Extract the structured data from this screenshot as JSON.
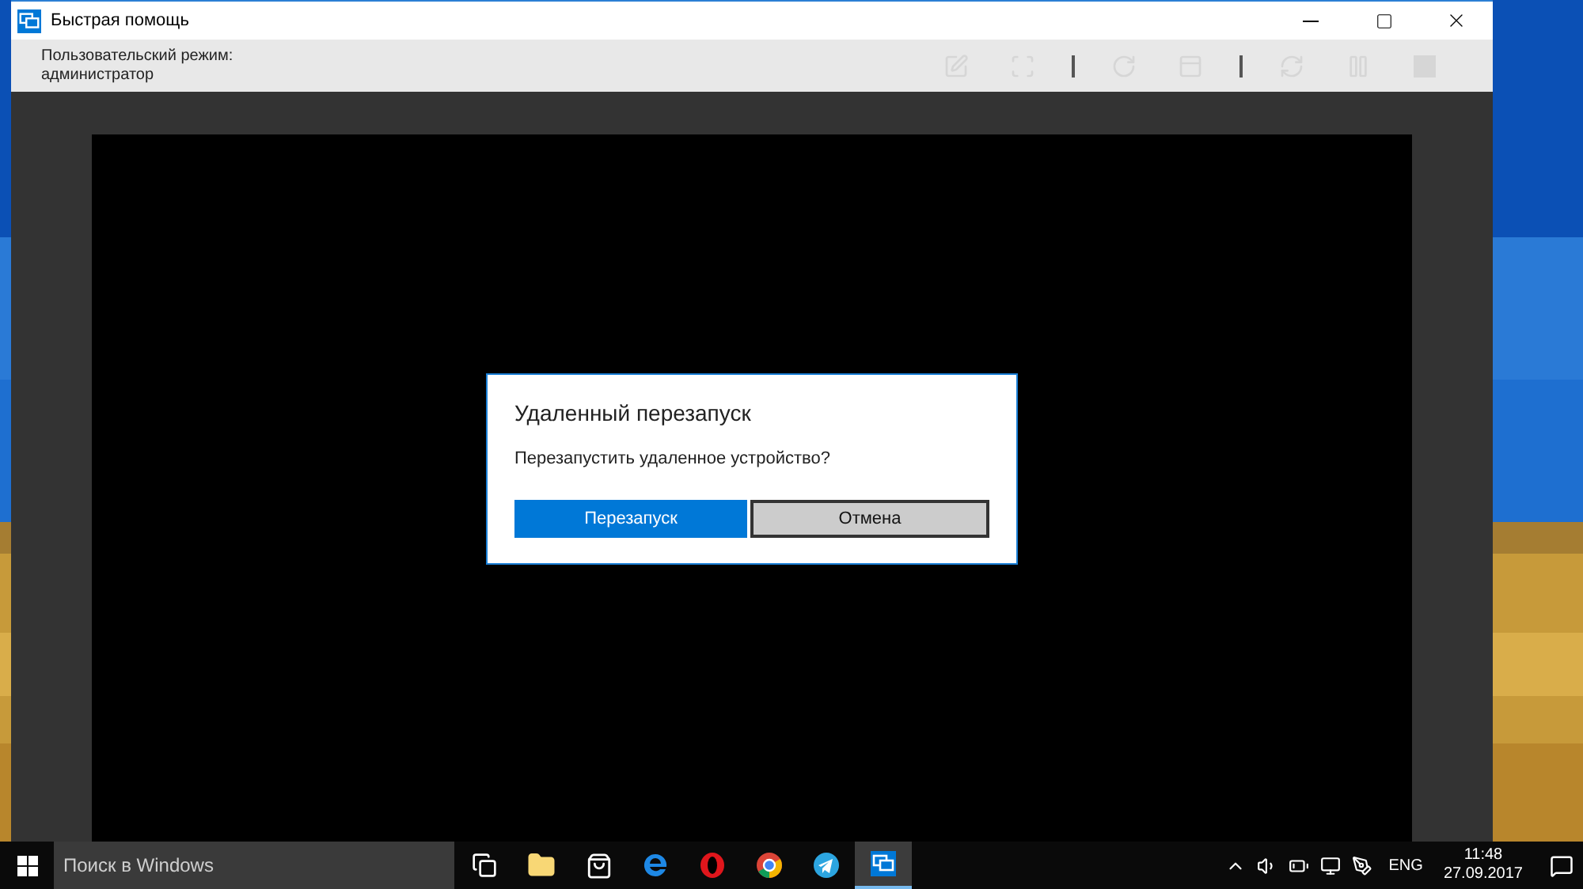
{
  "window": {
    "title": "Быстрая помощь",
    "mode_label": "Пользовательский режим:",
    "mode_value": "администратор"
  },
  "toolbar": [
    {
      "disabled": true
    },
    {
      "disabled": true
    },
    {
      "disabled": true
    },
    {
      "disabled": true
    },
    {
      "disabled": true
    },
    {
      "disabled": true
    },
    {
      "disabled": true
    }
  ],
  "dialog": {
    "title": "Удаленный перезапуск",
    "message": "Перезапустить удаленное устройство?",
    "buttons": [
      {
        "label": "Перезапуск",
        "primary": true
      },
      {
        "label": "Отмена",
        "primary": false
      }
    ]
  },
  "taskbar": {
    "search_placeholder": "Поиск в Windows",
    "apps": [
      {
        "selected": false
      },
      {
        "selected": false
      },
      {
        "selected": false
      },
      {
        "selected": false
      },
      {
        "selected": false
      },
      {
        "selected": false
      },
      {
        "selected": false
      },
      {
        "selected": true
      }
    ],
    "language": "ENG",
    "time": "11:48",
    "date": "27.09.2017"
  }
}
